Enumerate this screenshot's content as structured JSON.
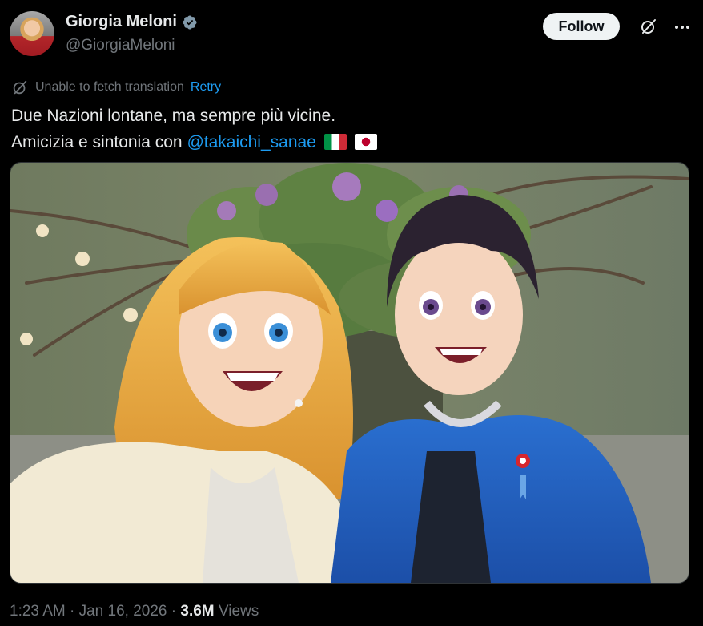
{
  "author": {
    "display_name": "Giorgia Meloni",
    "handle": "@GiorgiaMeloni",
    "verified": true
  },
  "actions": {
    "follow_label": "Follow",
    "grok_icon": "grok-icon",
    "more_icon": "more-icon"
  },
  "translation": {
    "message": "Unable to fetch translation",
    "retry_label": "Retry"
  },
  "tweet": {
    "line1": "Due Nazioni lontane, ma sempre più vicine.",
    "line2_prefix": "Amicizia e sintonia con ",
    "mention": "@takaichi_sanae",
    "flags": [
      "flag-italy",
      "flag-japan"
    ]
  },
  "media": {
    "type": "image",
    "subject": "anime-illustration-two-people-selfie"
  },
  "meta": {
    "time": "1:23 AM",
    "separator": " · ",
    "date": "Jan 16, 2026",
    "views_count": "3.6M",
    "views_label": "Views"
  },
  "colors": {
    "background": "#000000",
    "text_primary": "#e7e9ea",
    "text_secondary": "#71767b",
    "link": "#1d9bf0",
    "verified": "#829aab",
    "follow_bg": "#eff3f4"
  }
}
